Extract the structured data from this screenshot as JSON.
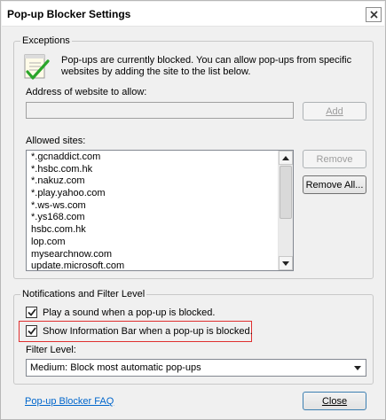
{
  "window": {
    "title": "Pop-up Blocker Settings"
  },
  "exceptions": {
    "group_label": "Exceptions",
    "info_text": "Pop-ups are currently blocked.  You can allow pop-ups from specific websites by adding the site to the list below.",
    "address_label": "Address of website to allow:",
    "address_value": "",
    "add_button": "Add",
    "allowed_label": "Allowed sites:",
    "allowed_sites": [
      "*.gcnaddict.com",
      "*.hsbc.com.hk",
      "*.nakuz.com",
      "*.play.yahoo.com",
      "*.ws-ws.com",
      "*.ys168.com",
      "hsbc.com.hk",
      "lop.com",
      "mysearchnow.com",
      "update.microsoft.com"
    ],
    "remove_button": "Remove",
    "remove_all_button": "Remove All..."
  },
  "notifications": {
    "group_label": "Notifications and Filter Level",
    "play_sound_label": "Play a sound when a pop-up is blocked.",
    "play_sound_checked": true,
    "info_bar_label": "Show Information Bar when a pop-up is blocked.",
    "info_bar_checked": true,
    "filter_label": "Filter Level:",
    "filter_value": "Medium: Block most automatic pop-ups"
  },
  "footer": {
    "faq_link": "Pop-up Blocker FAQ",
    "close_button": "Close"
  },
  "colors": {
    "highlight": "#e03030",
    "link": "#0066cc"
  }
}
